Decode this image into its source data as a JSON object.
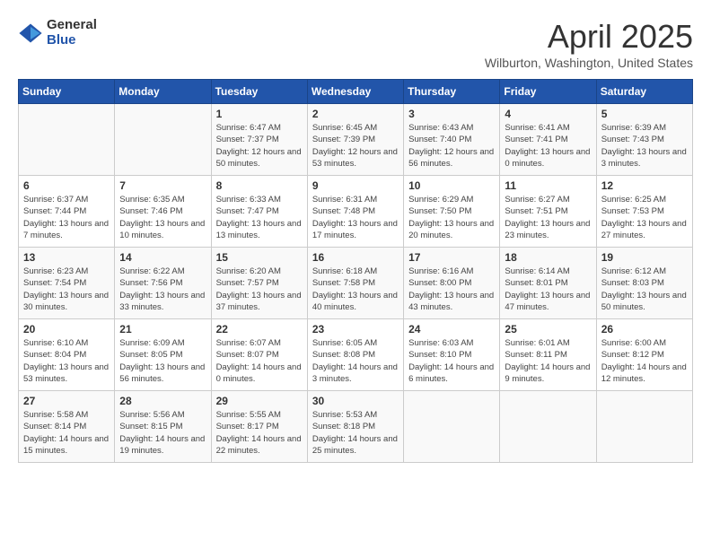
{
  "logo": {
    "general": "General",
    "blue": "Blue"
  },
  "title": "April 2025",
  "subtitle": "Wilburton, Washington, United States",
  "days_of_week": [
    "Sunday",
    "Monday",
    "Tuesday",
    "Wednesday",
    "Thursday",
    "Friday",
    "Saturday"
  ],
  "weeks": [
    [
      {
        "day": "",
        "info": ""
      },
      {
        "day": "",
        "info": ""
      },
      {
        "day": "1",
        "info": "Sunrise: 6:47 AM\nSunset: 7:37 PM\nDaylight: 12 hours and 50 minutes."
      },
      {
        "day": "2",
        "info": "Sunrise: 6:45 AM\nSunset: 7:39 PM\nDaylight: 12 hours and 53 minutes."
      },
      {
        "day": "3",
        "info": "Sunrise: 6:43 AM\nSunset: 7:40 PM\nDaylight: 12 hours and 56 minutes."
      },
      {
        "day": "4",
        "info": "Sunrise: 6:41 AM\nSunset: 7:41 PM\nDaylight: 13 hours and 0 minutes."
      },
      {
        "day": "5",
        "info": "Sunrise: 6:39 AM\nSunset: 7:43 PM\nDaylight: 13 hours and 3 minutes."
      }
    ],
    [
      {
        "day": "6",
        "info": "Sunrise: 6:37 AM\nSunset: 7:44 PM\nDaylight: 13 hours and 7 minutes."
      },
      {
        "day": "7",
        "info": "Sunrise: 6:35 AM\nSunset: 7:46 PM\nDaylight: 13 hours and 10 minutes."
      },
      {
        "day": "8",
        "info": "Sunrise: 6:33 AM\nSunset: 7:47 PM\nDaylight: 13 hours and 13 minutes."
      },
      {
        "day": "9",
        "info": "Sunrise: 6:31 AM\nSunset: 7:48 PM\nDaylight: 13 hours and 17 minutes."
      },
      {
        "day": "10",
        "info": "Sunrise: 6:29 AM\nSunset: 7:50 PM\nDaylight: 13 hours and 20 minutes."
      },
      {
        "day": "11",
        "info": "Sunrise: 6:27 AM\nSunset: 7:51 PM\nDaylight: 13 hours and 23 minutes."
      },
      {
        "day": "12",
        "info": "Sunrise: 6:25 AM\nSunset: 7:53 PM\nDaylight: 13 hours and 27 minutes."
      }
    ],
    [
      {
        "day": "13",
        "info": "Sunrise: 6:23 AM\nSunset: 7:54 PM\nDaylight: 13 hours and 30 minutes."
      },
      {
        "day": "14",
        "info": "Sunrise: 6:22 AM\nSunset: 7:56 PM\nDaylight: 13 hours and 33 minutes."
      },
      {
        "day": "15",
        "info": "Sunrise: 6:20 AM\nSunset: 7:57 PM\nDaylight: 13 hours and 37 minutes."
      },
      {
        "day": "16",
        "info": "Sunrise: 6:18 AM\nSunset: 7:58 PM\nDaylight: 13 hours and 40 minutes."
      },
      {
        "day": "17",
        "info": "Sunrise: 6:16 AM\nSunset: 8:00 PM\nDaylight: 13 hours and 43 minutes."
      },
      {
        "day": "18",
        "info": "Sunrise: 6:14 AM\nSunset: 8:01 PM\nDaylight: 13 hours and 47 minutes."
      },
      {
        "day": "19",
        "info": "Sunrise: 6:12 AM\nSunset: 8:03 PM\nDaylight: 13 hours and 50 minutes."
      }
    ],
    [
      {
        "day": "20",
        "info": "Sunrise: 6:10 AM\nSunset: 8:04 PM\nDaylight: 13 hours and 53 minutes."
      },
      {
        "day": "21",
        "info": "Sunrise: 6:09 AM\nSunset: 8:05 PM\nDaylight: 13 hours and 56 minutes."
      },
      {
        "day": "22",
        "info": "Sunrise: 6:07 AM\nSunset: 8:07 PM\nDaylight: 14 hours and 0 minutes."
      },
      {
        "day": "23",
        "info": "Sunrise: 6:05 AM\nSunset: 8:08 PM\nDaylight: 14 hours and 3 minutes."
      },
      {
        "day": "24",
        "info": "Sunrise: 6:03 AM\nSunset: 8:10 PM\nDaylight: 14 hours and 6 minutes."
      },
      {
        "day": "25",
        "info": "Sunrise: 6:01 AM\nSunset: 8:11 PM\nDaylight: 14 hours and 9 minutes."
      },
      {
        "day": "26",
        "info": "Sunrise: 6:00 AM\nSunset: 8:12 PM\nDaylight: 14 hours and 12 minutes."
      }
    ],
    [
      {
        "day": "27",
        "info": "Sunrise: 5:58 AM\nSunset: 8:14 PM\nDaylight: 14 hours and 15 minutes."
      },
      {
        "day": "28",
        "info": "Sunrise: 5:56 AM\nSunset: 8:15 PM\nDaylight: 14 hours and 19 minutes."
      },
      {
        "day": "29",
        "info": "Sunrise: 5:55 AM\nSunset: 8:17 PM\nDaylight: 14 hours and 22 minutes."
      },
      {
        "day": "30",
        "info": "Sunrise: 5:53 AM\nSunset: 8:18 PM\nDaylight: 14 hours and 25 minutes."
      },
      {
        "day": "",
        "info": ""
      },
      {
        "day": "",
        "info": ""
      },
      {
        "day": "",
        "info": ""
      }
    ]
  ]
}
